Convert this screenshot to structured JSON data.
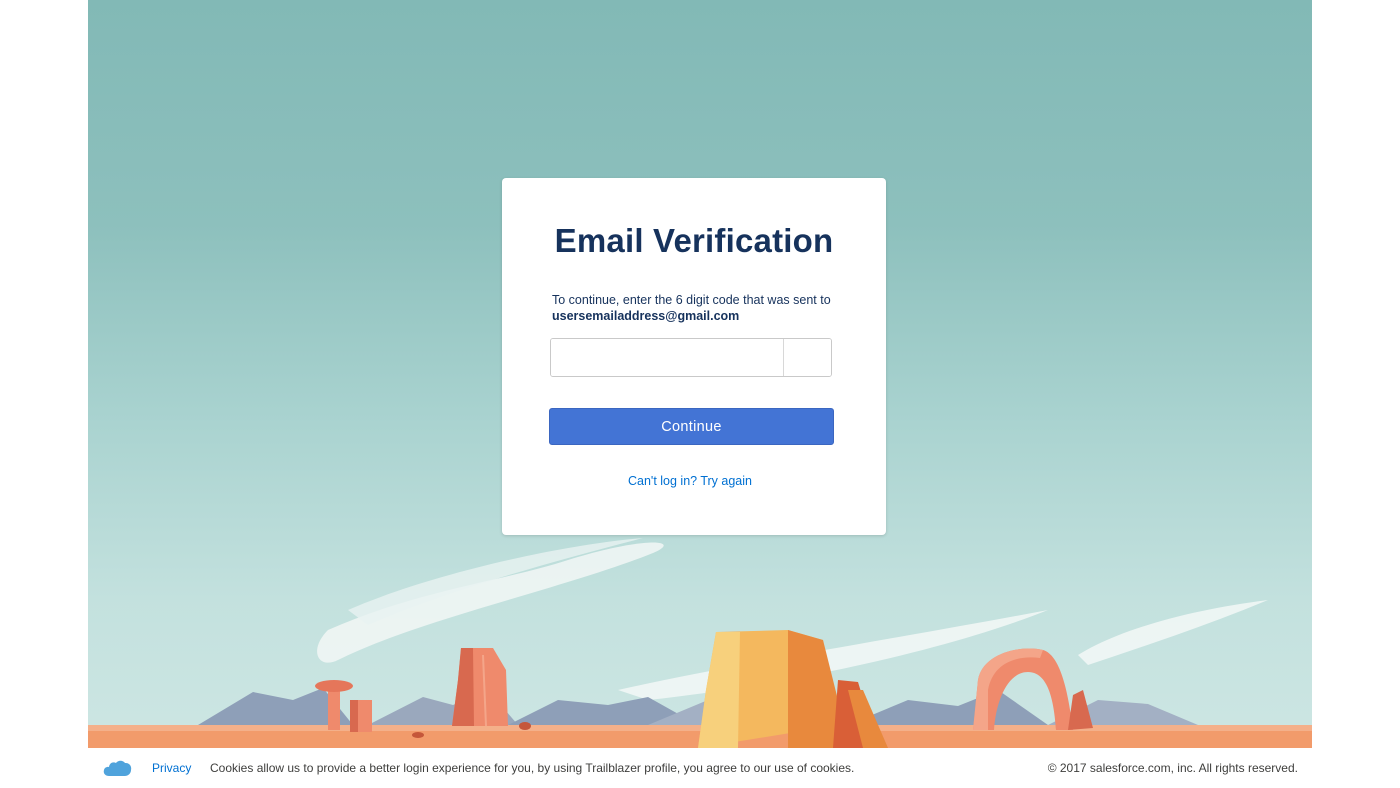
{
  "card": {
    "title": "Email Verification",
    "instructions_prefix": "To continue, enter the 6 digit code that was sent to",
    "email": "usersemailaddress@gmail.com",
    "code_digits": [
      "",
      "",
      "",
      "",
      "",
      ""
    ],
    "continue_label": "Continue",
    "help_link": "Can't log in? Try again"
  },
  "footer": {
    "logo_icon": "salesforce-cloud-icon",
    "privacy_label": "Privacy",
    "cookie_notice": "Cookies allow us to provide a better login experience for you, by using Trailblazer profile, you agree to our use of cookies.",
    "copyright": "© 2017 salesforce.com, inc. All rights reserved."
  },
  "colors": {
    "sky_top": "#82b9b6",
    "sky_bottom": "#cde6e3",
    "primary_button": "#4374d5",
    "link": "#0070d2",
    "title_text": "#16325c",
    "ground": "#f29b6b",
    "rock": "#ef8a6c",
    "mesa": "#f4b85e",
    "mountain": "#8e9fb8"
  }
}
